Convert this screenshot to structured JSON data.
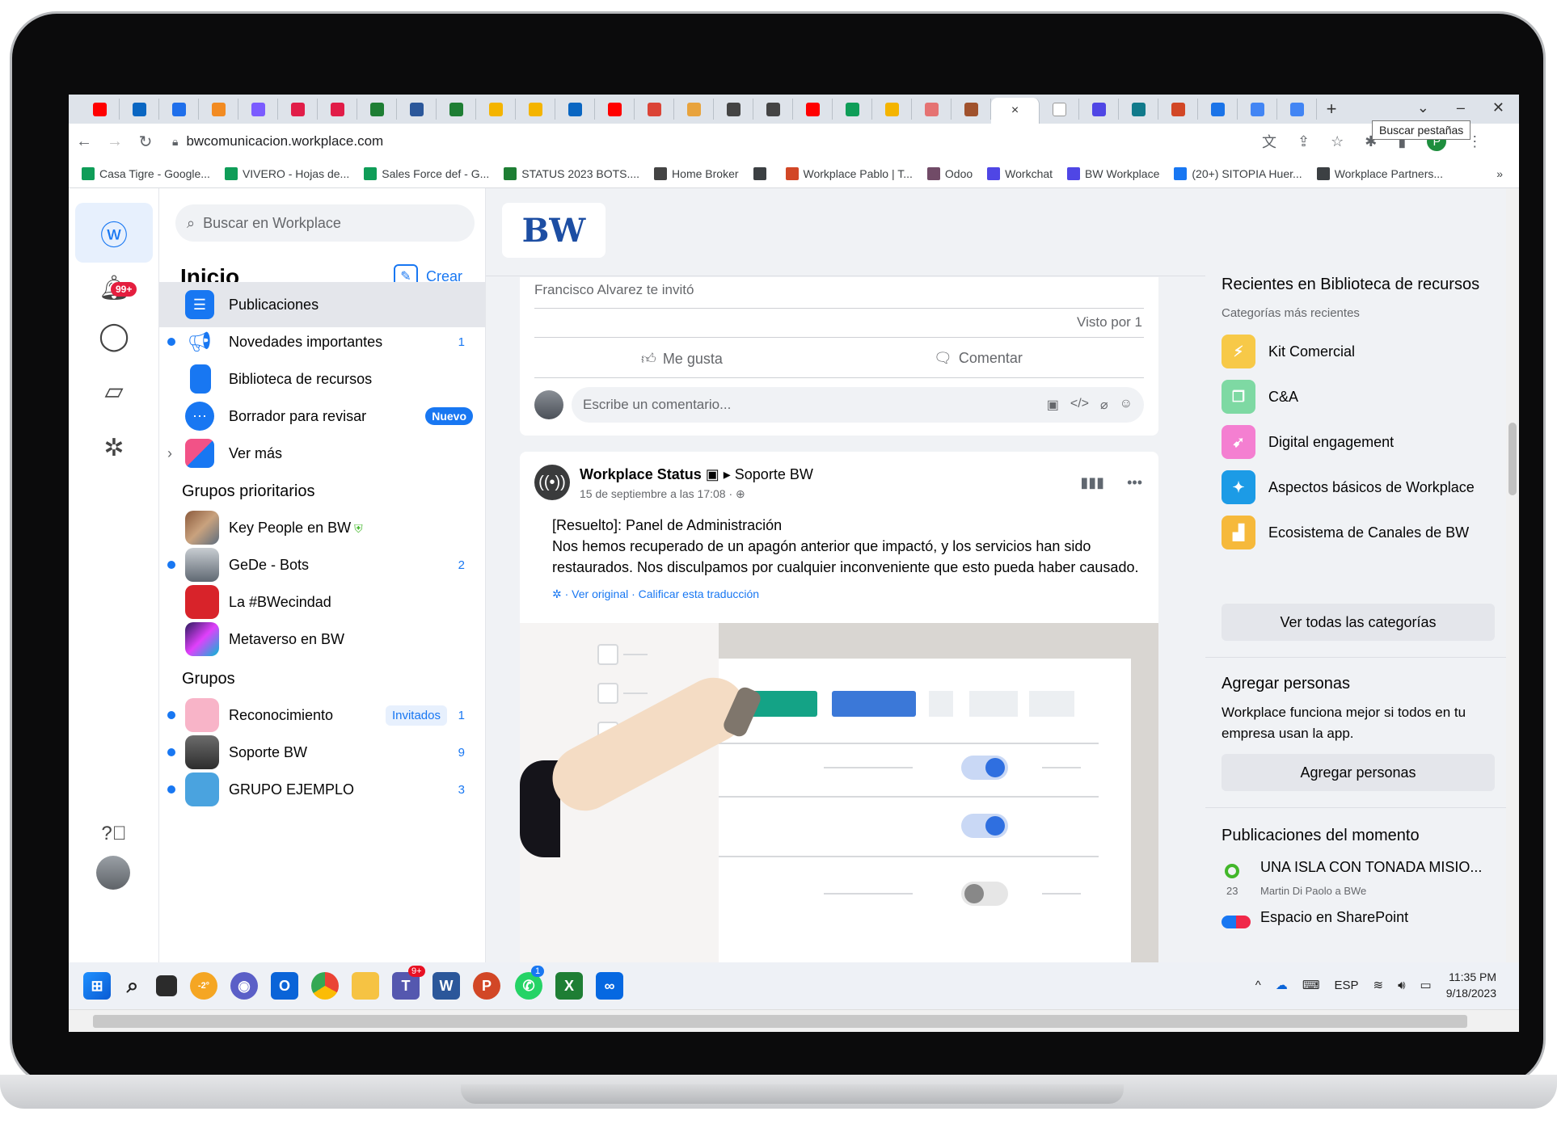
{
  "browser": {
    "tab_tooltip": "Buscar pestañas",
    "url": "bwcomunicacion.workplace.com",
    "tab_colors": [
      "#ff0000",
      "#0a66c2",
      "#1f6feb",
      "#f28b22",
      "#7b5cff",
      "#e11d48",
      "#e11d48",
      "#1e7e34",
      "#2b579a",
      "#1e7e34",
      "#f4b400",
      "#f4b400",
      "#0a66c2",
      "#ff0000",
      "#db4437",
      "#e8a33d",
      "#444444",
      "#444444",
      "#ff0000",
      "#0f9d58",
      "#f4b400",
      "#e57373",
      "#a0522d",
      "#ffffff",
      "#4f46e5",
      "#117a8b",
      "#d24726",
      "#1a73e8",
      "#4285f4",
      "#4285f4"
    ],
    "bookmarks": [
      {
        "label": "Casa Tigre - Google...",
        "color": "#0f9d58"
      },
      {
        "label": "VIVERO - Hojas de...",
        "color": "#0f9d58"
      },
      {
        "label": "Sales Force def - G...",
        "color": "#0f9d58"
      },
      {
        "label": "STATUS 2023 BOTS....",
        "color": "#1e7e34"
      },
      {
        "label": "Home Broker",
        "color": "#444444"
      },
      {
        "label": "",
        "color": "#3c4043"
      },
      {
        "label": "Workplace Pablo | T...",
        "color": "#d24726"
      },
      {
        "label": "Odoo",
        "color": "#714b67"
      },
      {
        "label": "Workchat",
        "color": "#4f46e5"
      },
      {
        "label": "BW Workplace",
        "color": "#4f46e5"
      },
      {
        "label": "(20+) SITOPIA Huer...",
        "color": "#1877f2"
      },
      {
        "label": "Workplace Partners...",
        "color": "#3c4043"
      }
    ],
    "more_bookmarks": "»"
  },
  "sidebar": {
    "notif_badge": "99+",
    "search_placeholder": "Buscar en Workplace",
    "title": "Inicio",
    "create_label": "Crear",
    "items": [
      {
        "label": "Publicaciones",
        "color": "#1877f2"
      },
      {
        "label": "Novedades importantes",
        "count": "1",
        "color": "#1877f2"
      },
      {
        "label": "Biblioteca de recursos",
        "color": "#1877f2"
      },
      {
        "label": "Borrador para revisar",
        "pill": "Nuevo",
        "color": "#1877f2"
      },
      {
        "label": "Ver más",
        "color": "#f25287"
      }
    ],
    "priority_header": "Grupos prioritarios",
    "priority_groups": [
      {
        "label": "Key People en BW"
      },
      {
        "label": "GeDe - Bots",
        "count": "2"
      },
      {
        "label": "La #BWecindad"
      },
      {
        "label": "Metaverso en BW"
      }
    ],
    "groups_header": "Grupos",
    "groups": [
      {
        "label": "Reconocimiento",
        "pill": "Invitados",
        "count": "1"
      },
      {
        "label": "Soporte BW",
        "count": "9"
      },
      {
        "label": "GRUPO EJEMPLO",
        "count": "3"
      }
    ]
  },
  "feed": {
    "logo": "BW",
    "post1": {
      "invited_text": "Francisco Alvarez te invitó",
      "seen_by": "Visto por 1",
      "like_label": "Me gusta",
      "comment_label": "Comentar",
      "comment_placeholder": "Escribe un comentario..."
    },
    "post2": {
      "author": "Workplace Status",
      "group": "Soporte BW",
      "date": "15 de septiembre a las 17:08 · ",
      "line1": "[Resuelto]: Panel de Administración",
      "line2": "Nos hemos recuperado de un apagón anterior que impactó, y los servicios han sido",
      "line3": "restaurados. Nos disculpamos por cualquier inconveniente que esto pueda haber causado.",
      "translation": "· Ver original · Calificar esta traducción"
    }
  },
  "right": {
    "library_title": "Recientes en Biblioteca de recursos",
    "library_sub": "Categorías más recientes",
    "categories": [
      {
        "label": "Kit Comercial",
        "color": "#f7c948"
      },
      {
        "label": "C&A",
        "color": "#7ed9a3"
      },
      {
        "label": "Digital engagement",
        "color": "#f47fd1"
      },
      {
        "label": "Aspectos básicos de Workplace",
        "color": "#1c9be6"
      },
      {
        "label": "Ecosistema de Canales de BW",
        "color": "#f6b93b"
      }
    ],
    "all_categories": "Ver todas las categorías",
    "add_title": "Agregar personas",
    "add_text": "Workplace funciona mejor si todos en tu empresa usan la app.",
    "add_button": "Agregar personas",
    "trending_title": "Publicaciones del momento",
    "trending": [
      {
        "title": "UNA ISLA CON TONADA MISIO...",
        "count": "23",
        "meta": "Martin Di Paolo a BWe"
      },
      {
        "title": "Espacio en SharePoint"
      }
    ]
  },
  "taskbar": {
    "weather": "-2°",
    "teams_badge": "9+",
    "whatsapp_badge": "1",
    "lang": "ESP",
    "time": "11:35 PM",
    "date": "9/18/2023"
  }
}
